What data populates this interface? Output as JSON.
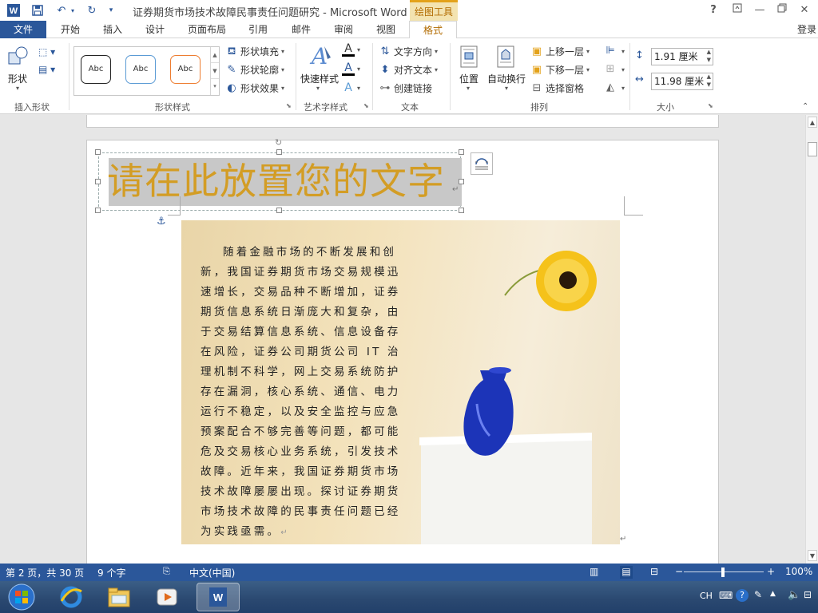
{
  "titlebar": {
    "doc_title": "证券期货市场技术故障民事责任问题研究 - Microsoft Word",
    "context_tab_label": "绘图工具",
    "help_label": "?"
  },
  "tabs": {
    "file": "文件",
    "items": [
      "开始",
      "插入",
      "设计",
      "页面布局",
      "引用",
      "邮件",
      "审阅",
      "视图",
      "格式"
    ],
    "signin": "登录"
  },
  "ribbon": {
    "insert_shapes": {
      "shape_label": "形状",
      "group_label": "插入形状"
    },
    "shape_styles": {
      "gallery": [
        "Abc",
        "Abc",
        "Abc"
      ],
      "fill": "形状填充",
      "outline": "形状轮廓",
      "effects": "形状效果",
      "group_label": "形状样式"
    },
    "wordart": {
      "quick_styles": "快速样式",
      "group_label": "艺术字样式"
    },
    "text": {
      "direction": "文字方向",
      "align": "对齐文本",
      "link": "创建链接",
      "group_label": "文本"
    },
    "arrange": {
      "position": "位置",
      "wrap": "自动换行",
      "bring_forward": "上移一层",
      "send_backward": "下移一层",
      "selection_pane": "选择窗格",
      "group_label": "排列"
    },
    "size": {
      "height": "1.91 厘米",
      "width": "11.98 厘米",
      "group_label": "大小"
    }
  },
  "document": {
    "headline": "请在此放置您的文字",
    "paragraph": "随着金融市场的不断发展和创新，我国证券期货市场交易规模迅速增长，交易品种不断增加，证券期货信息系统日渐庞大和复杂，由于交易结算信息系统、信息设备存在风险，证券公司期货公司 IT 治理机制不科学，网上交易系统防护存在漏洞，核心系统、通信、电力运行不稳定，以及安全监控与应急预案配合不够完善等问题，都可能危及交易核心业务系统，引发技术故障。近年来，我国证券期货市场技术故障屡屡出现。探讨证券期货市场技术故障的民事责任问题已经为实践亟需。"
  },
  "statusbar": {
    "page": "第 2 页，共 30 页",
    "words": "9 个字",
    "language": "中文(中国)",
    "zoom": "100%",
    "zoom_minus": "−",
    "zoom_plus": "+"
  },
  "taskbar": {
    "tray_lang": "CH"
  },
  "colors": {
    "brand": "#2b579a",
    "context_accent": "#e3a21a",
    "headline": "#d39d25"
  }
}
